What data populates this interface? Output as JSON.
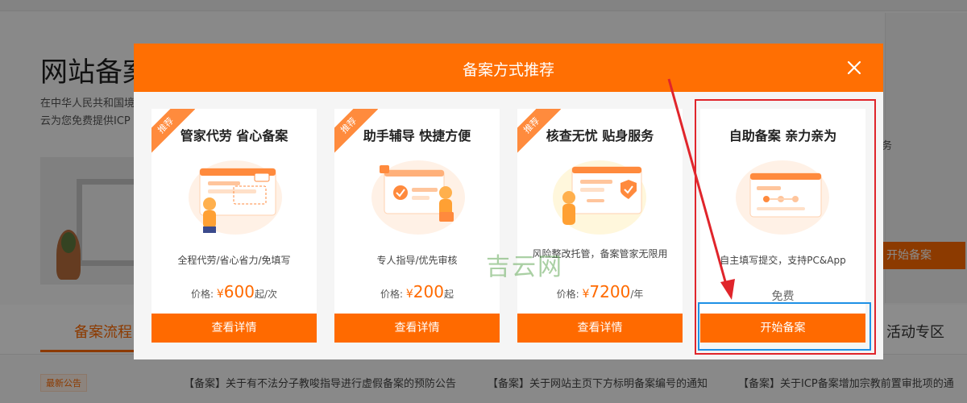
{
  "background": {
    "page_title": "网站备案",
    "desc_line1": "在中华人民共和国境",
    "desc_line2": "云为您免费提供ICP",
    "right_text": "务",
    "right_button_label": "开始备案",
    "tab_active": "备案流程",
    "tab_right": "活动专区",
    "news_badge": "最新公告",
    "news": [
      "【备案】关于有不法分子教唆指导进行虚假备案的预防公告",
      "【备案】关于网站主页下方标明备案编号的通知",
      "【备案】关于ICP备案增加宗教前置审批项的通"
    ]
  },
  "modal": {
    "title": "备案方式推荐",
    "close_icon": "close-icon",
    "cards": [
      {
        "ribbon": "推荐",
        "title": "管家代劳 省心备案",
        "desc": "全程代劳/省心省力/免填写",
        "price_label": "价格:",
        "currency": "¥",
        "price": "600",
        "unit": "起/次",
        "button": "查看详情"
      },
      {
        "ribbon": "推荐",
        "title": "助手辅导 快捷方便",
        "desc": "专人指导/优先审核",
        "price_label": "价格:",
        "currency": "¥",
        "price": "200",
        "unit": "起",
        "button": "查看详情"
      },
      {
        "ribbon": "推荐",
        "title": "核查无忧 贴身服务",
        "desc": "风险整改托管，备案管家无限用",
        "price_label": "价格:",
        "currency": "¥",
        "price": "7200",
        "unit": "/年",
        "button": "查看详情"
      },
      {
        "title": "自助备案 亲力亲为",
        "desc": "自主填写提交，支持PC&App",
        "free_label": "免费",
        "button": "开始备案"
      }
    ]
  },
  "watermark": "吉云网",
  "colors": {
    "brand_orange": "#ff6a00",
    "header_orange": "#ff6f03",
    "annotation_red": "#e0252b",
    "annotation_blue": "#1e90e6"
  }
}
